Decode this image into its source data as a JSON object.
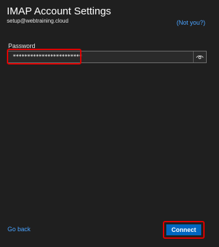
{
  "header": {
    "title": "IMAP Account Settings",
    "email": "setup@webtraining.cloud",
    "not_you_link": "(Not you?)"
  },
  "password": {
    "label": "Password",
    "value": "************************",
    "reveal_icon": "eye-icon"
  },
  "footer": {
    "go_back_link": "Go back",
    "connect_label": "Connect"
  },
  "colors": {
    "background": "#1f1f1f",
    "link": "#4aa3ff",
    "primary_button": "#0067c0",
    "highlight": "#e00000"
  }
}
